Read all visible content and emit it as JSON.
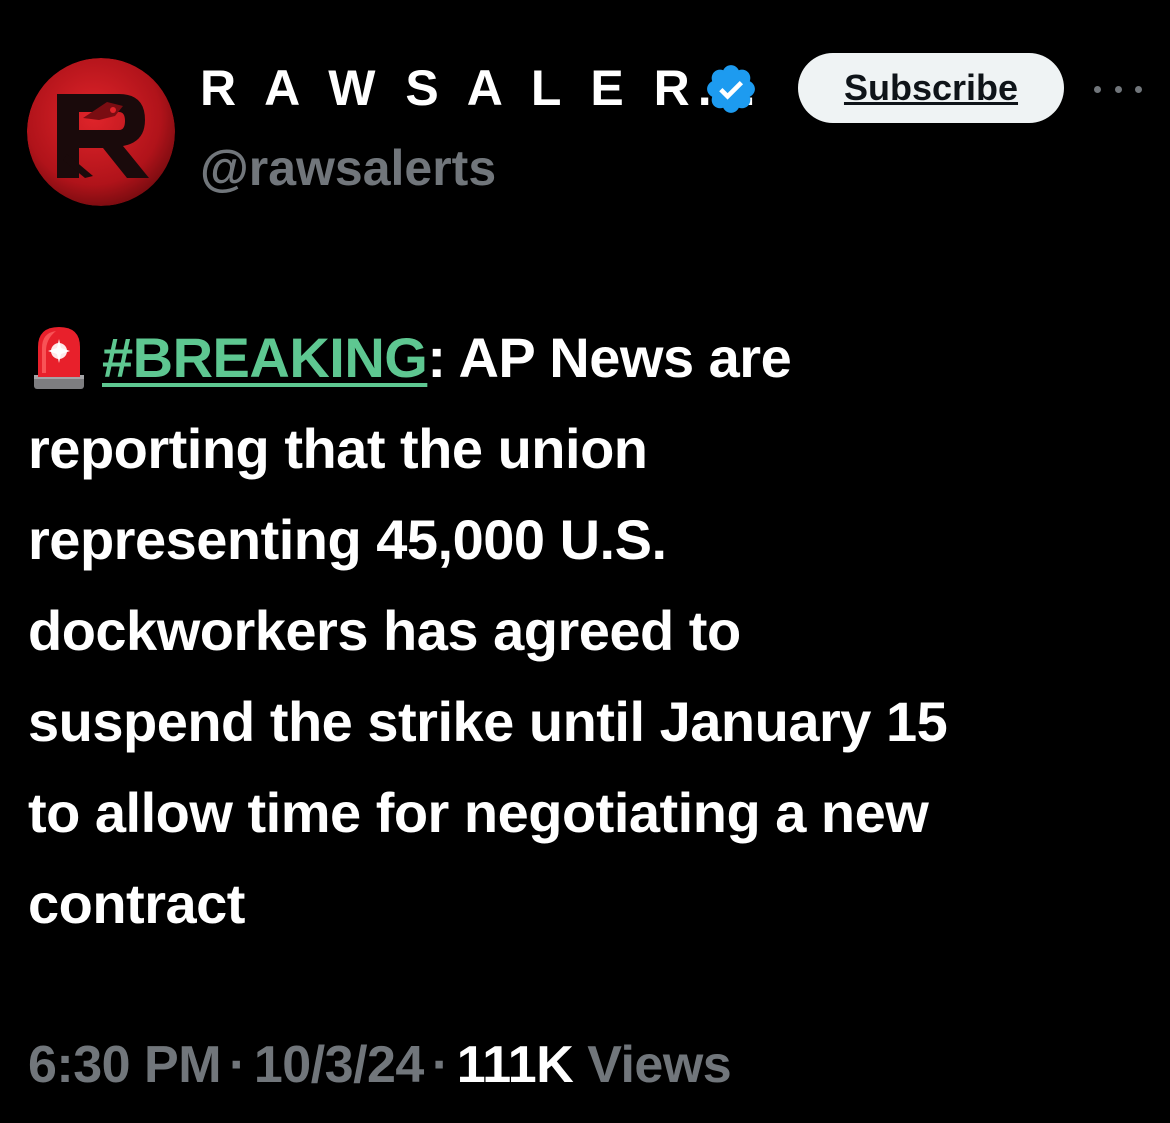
{
  "author": {
    "display_name": "R A W S A L E R...",
    "handle": "@rawsalerts",
    "verified": true,
    "avatar_icon": "raws-eagle-logo-icon"
  },
  "header": {
    "subscribe_label": "Subscribe",
    "more_icon": "more-dots-icon"
  },
  "tweet": {
    "emoji_icon": "police-siren-icon",
    "hashtag": "#BREAKING",
    "after_hashtag": ": AP News are",
    "lines": [
      "reporting that the union",
      "representing 45,000 U.S.",
      "dockworkers has agreed to",
      "suspend the strike until January 15",
      "to allow time for negotiating a new",
      "contract"
    ]
  },
  "meta": {
    "time": "6:30 PM",
    "separator": "·",
    "date": "10/3/24",
    "views_count": "111K",
    "views_label": "Views"
  },
  "colors": {
    "background": "#000000",
    "text": "#ffffff",
    "secondary": "#71767b",
    "hashtag": "#5ec791",
    "verified": "#1d9bf0",
    "avatar_red": "#c0161c"
  }
}
